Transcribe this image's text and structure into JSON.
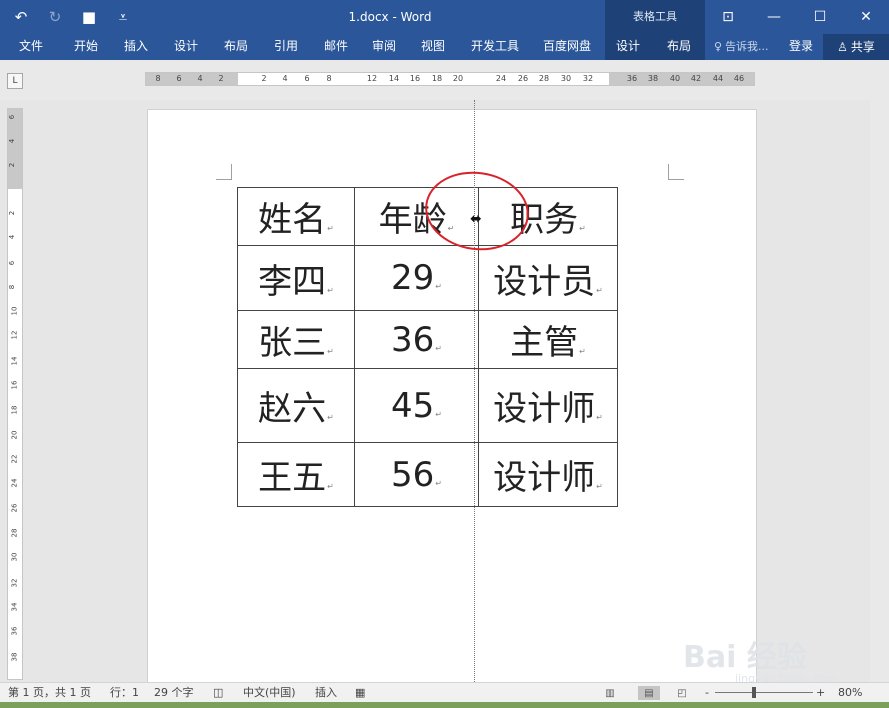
{
  "window": {
    "title": "1.docx - Word",
    "context_tools": "表格工具",
    "controls": [
      "⊡",
      "—",
      "☐",
      "✕"
    ]
  },
  "qat": {
    "undo": "↶",
    "redo": "↻",
    "save": "■",
    "customize": "⩡"
  },
  "ribbon": {
    "tabs": [
      "文件",
      "开始",
      "插入",
      "设计",
      "布局",
      "引用",
      "邮件",
      "审阅",
      "视图",
      "开发工具",
      "百度网盘",
      "设计",
      "布局"
    ],
    "tell_me": "告诉我...",
    "login": "登录",
    "share": "共享"
  },
  "ruler": {
    "corner": "L",
    "h_numbers": [
      "8",
      "6",
      "4",
      "2",
      "2",
      "4",
      "6",
      "8",
      "12",
      "14",
      "16",
      "18",
      "20",
      "24",
      "26",
      "28",
      "30",
      "32",
      "36",
      "38",
      "40",
      "42",
      "44",
      "46"
    ],
    "v_numbers": [
      "6",
      "4",
      "2",
      "2",
      "4",
      "6",
      "8",
      "10",
      "12",
      "14",
      "16",
      "18",
      "20",
      "22",
      "24",
      "26",
      "28",
      "30",
      "32",
      "34",
      "36",
      "38"
    ]
  },
  "table": {
    "rows": [
      [
        "姓名",
        "年龄",
        "职务"
      ],
      [
        "李四",
        "29",
        "设计员"
      ],
      [
        "张三",
        "36",
        "主管"
      ],
      [
        "赵六",
        "45",
        "设计师"
      ],
      [
        "王五",
        "56",
        "设计师"
      ]
    ],
    "cell_mark": "↵"
  },
  "cursor": "⬌",
  "status": {
    "page": "第 1 页，共 1 页",
    "line": "行：1",
    "words": "29 个字",
    "language": "中文(中国)",
    "insert_mode": "插入",
    "zoom": "80%",
    "zoom_minus": "-",
    "zoom_plus": "+"
  },
  "watermark": {
    "text": "Bai 经验",
    "sub": "jingyan.baidu.com"
  },
  "colors": {
    "accent": "#2b579a",
    "annotation": "#d8232a"
  }
}
